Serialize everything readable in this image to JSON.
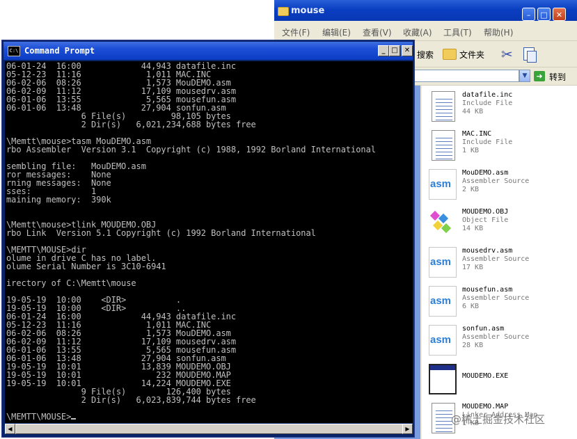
{
  "explorer": {
    "title": "mouse",
    "menu": [
      "文件(F)",
      "编辑(E)",
      "查看(V)",
      "收藏(A)",
      "工具(T)",
      "帮助(H)"
    ],
    "toolbar": {
      "search_label": "搜索",
      "folders_label": "文件夹"
    },
    "address": {
      "value": "",
      "go_label": "转到"
    },
    "files": [
      {
        "name": "datafile.inc",
        "type": "Include File",
        "size": "44 KB",
        "icon": "document-icon"
      },
      {
        "name": "MAC.INC",
        "type": "Include File",
        "size": "1 KB",
        "icon": "document-icon"
      },
      {
        "name": "MouDEMO.asm",
        "type": "Assembler Source",
        "size": "2 KB",
        "icon": "asm-icon"
      },
      {
        "name": "MOUDEMO.OBJ",
        "type": "Object File",
        "size": "14 KB",
        "icon": "object-file-icon"
      },
      {
        "name": "mousedrv.asm",
        "type": "Assembler Source",
        "size": "17 KB",
        "icon": "asm-icon"
      },
      {
        "name": "mousefun.asm",
        "type": "Assembler Source",
        "size": "6 KB",
        "icon": "asm-icon"
      },
      {
        "name": "sonfun.asm",
        "type": "Assembler Source",
        "size": "28 KB",
        "icon": "asm-icon"
      },
      {
        "name": "MOUDEMO.EXE",
        "type": "",
        "size": "",
        "icon": "exe-window-icon"
      },
      {
        "name": "MOUDEMO.MAP",
        "type": "Linker Address Map",
        "size": "1 KB",
        "icon": "document-icon"
      }
    ],
    "asm_icon_text": "asm"
  },
  "cmd": {
    "title": "Command Prompt",
    "icon_text": "C:\\",
    "lines": [
      "06-01-24  16:00            44,943 datafile.inc",
      "05-12-23  11:16             1,011 MAC.INC",
      "06-02-06  08:26             1,573 MouDEMO.asm",
      "06-02-09  11:12            17,109 mousedrv.asm",
      "06-01-06  13:55             5,565 mousefun.asm",
      "06-01-06  13:48            27,904 sonfun.asm",
      "               6 File(s)         98,105 bytes",
      "               2 Dir(s)   6,021,234,688 bytes free",
      "",
      "\\Memtt\\mouse>tasm MouDEMO.asm",
      "rbo Assembler  Version 3.1  Copyright (c) 1988, 1992 Borland International",
      "",
      "sembling file:   MouDEMO.asm",
      "ror messages:    None",
      "rning messages:  None",
      "sses:            1",
      "maining memory:  390k",
      "",
      "",
      "\\Memtt\\mouse>tlink MOUDEMO.OBJ",
      "rbo Link  Version 5.1 Copyright (c) 1992 Borland International",
      "",
      "\\MEMTT\\MOUSE>dir",
      "olume in drive C has no label.",
      "olume Serial Number is 3C10-6941",
      "",
      "irectory of C:\\Memtt\\mouse",
      "",
      "19-05-19  10:00    <DIR>          .",
      "19-05-19  10:00    <DIR>          ..",
      "06-01-24  16:00            44,943 datafile.inc",
      "05-12-23  11:16             1,011 MAC.INC",
      "06-02-06  08:26             1,573 MouDEMO.asm",
      "06-02-09  11:12            17,109 mousedrv.asm",
      "06-01-06  13:55             5,565 mousefun.asm",
      "06-01-06  13:48            27,904 sonfun.asm",
      "19-05-19  10:01            13,839 MOUDEMO.OBJ",
      "19-05-19  10:01               232 MOUDEMO.MAP",
      "19-05-19  10:01            14,224 MOUDEMO.EXE",
      "               9 File(s)        126,400 bytes",
      "               2 Dir(s)   6,023,839,744 bytes free",
      "",
      "\\MEMTT\\MOUSE>"
    ]
  },
  "watermark": "@稀土掘金技术社区"
}
